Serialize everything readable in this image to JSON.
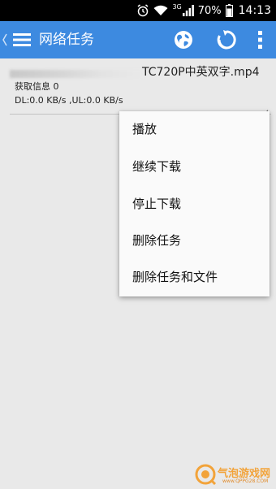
{
  "status_bar": {
    "network_type": "3G",
    "battery": "70%",
    "time": "14:13",
    "icons": [
      "alarm-icon",
      "wifi-icon",
      "signal-icon",
      "battery-icon"
    ]
  },
  "app_bar": {
    "title": "网络任务",
    "icons": [
      "back-chevron-icon",
      "menu-icon",
      "globe-icon",
      "refresh-icon",
      "overflow-icon"
    ],
    "accent_color": "#3d8ae0"
  },
  "task": {
    "file_name_visible": "TC720P中英双字.mp4",
    "status": "获取信息  0",
    "speed": "DL:0.0 KB/s ,UL:0.0 KB/s"
  },
  "context_menu": {
    "items": [
      "播放",
      "继续下载",
      "停止下载",
      "删除任务",
      "删除任务和文件"
    ]
  },
  "watermark": {
    "text": "气泡游戏网",
    "url": "www.QPPG28.COM",
    "color": "#f2a33a"
  }
}
